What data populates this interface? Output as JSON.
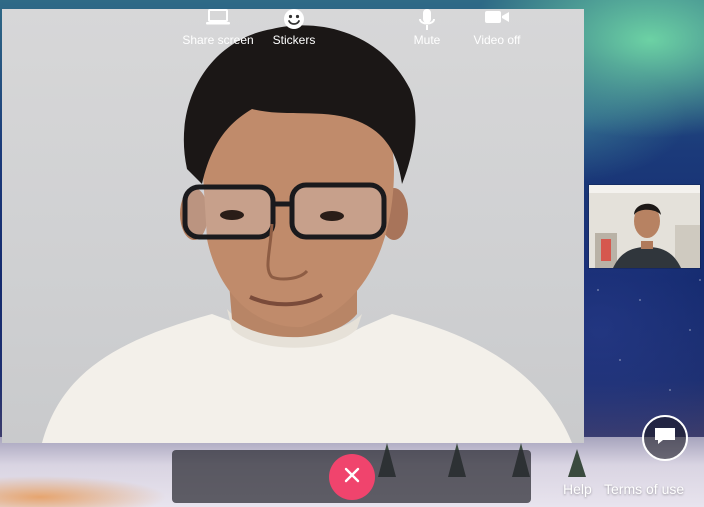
{
  "controls": {
    "share_screen": "Share screen",
    "stickers": "Stickers",
    "mute": "Mute",
    "video_off": "Video off"
  },
  "footer": {
    "help": "Help",
    "terms": "Terms of use"
  },
  "icons": {
    "share_screen": "laptop-icon",
    "stickers": "smiley-icon",
    "hangup": "close-icon",
    "mute": "microphone-icon",
    "video_off": "video-camera-icon",
    "chat": "chat-bubble-icon"
  },
  "colors": {
    "hangup": "#f0446d",
    "control_bar": "rgba(40,40,48,0.72)"
  }
}
